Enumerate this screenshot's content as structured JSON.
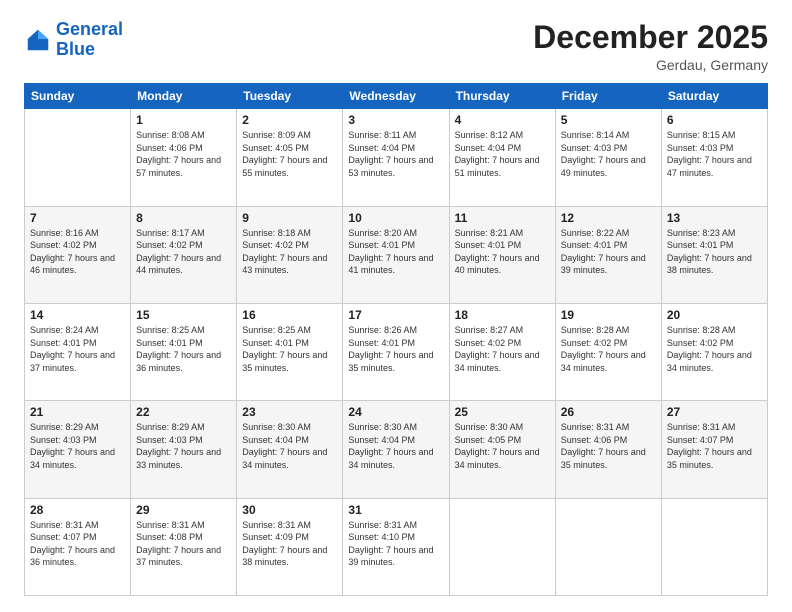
{
  "logo": {
    "line1": "General",
    "line2": "Blue"
  },
  "header": {
    "month": "December 2025",
    "location": "Gerdau, Germany"
  },
  "days_of_week": [
    "Sunday",
    "Monday",
    "Tuesday",
    "Wednesday",
    "Thursday",
    "Friday",
    "Saturday"
  ],
  "weeks": [
    [
      {
        "day": "",
        "sunrise": "",
        "sunset": "",
        "daylight": ""
      },
      {
        "day": "1",
        "sunrise": "Sunrise: 8:08 AM",
        "sunset": "Sunset: 4:06 PM",
        "daylight": "Daylight: 7 hours and 57 minutes."
      },
      {
        "day": "2",
        "sunrise": "Sunrise: 8:09 AM",
        "sunset": "Sunset: 4:05 PM",
        "daylight": "Daylight: 7 hours and 55 minutes."
      },
      {
        "day": "3",
        "sunrise": "Sunrise: 8:11 AM",
        "sunset": "Sunset: 4:04 PM",
        "daylight": "Daylight: 7 hours and 53 minutes."
      },
      {
        "day": "4",
        "sunrise": "Sunrise: 8:12 AM",
        "sunset": "Sunset: 4:04 PM",
        "daylight": "Daylight: 7 hours and 51 minutes."
      },
      {
        "day": "5",
        "sunrise": "Sunrise: 8:14 AM",
        "sunset": "Sunset: 4:03 PM",
        "daylight": "Daylight: 7 hours and 49 minutes."
      },
      {
        "day": "6",
        "sunrise": "Sunrise: 8:15 AM",
        "sunset": "Sunset: 4:03 PM",
        "daylight": "Daylight: 7 hours and 47 minutes."
      }
    ],
    [
      {
        "day": "7",
        "sunrise": "Sunrise: 8:16 AM",
        "sunset": "Sunset: 4:02 PM",
        "daylight": "Daylight: 7 hours and 46 minutes."
      },
      {
        "day": "8",
        "sunrise": "Sunrise: 8:17 AM",
        "sunset": "Sunset: 4:02 PM",
        "daylight": "Daylight: 7 hours and 44 minutes."
      },
      {
        "day": "9",
        "sunrise": "Sunrise: 8:18 AM",
        "sunset": "Sunset: 4:02 PM",
        "daylight": "Daylight: 7 hours and 43 minutes."
      },
      {
        "day": "10",
        "sunrise": "Sunrise: 8:20 AM",
        "sunset": "Sunset: 4:01 PM",
        "daylight": "Daylight: 7 hours and 41 minutes."
      },
      {
        "day": "11",
        "sunrise": "Sunrise: 8:21 AM",
        "sunset": "Sunset: 4:01 PM",
        "daylight": "Daylight: 7 hours and 40 minutes."
      },
      {
        "day": "12",
        "sunrise": "Sunrise: 8:22 AM",
        "sunset": "Sunset: 4:01 PM",
        "daylight": "Daylight: 7 hours and 39 minutes."
      },
      {
        "day": "13",
        "sunrise": "Sunrise: 8:23 AM",
        "sunset": "Sunset: 4:01 PM",
        "daylight": "Daylight: 7 hours and 38 minutes."
      }
    ],
    [
      {
        "day": "14",
        "sunrise": "Sunrise: 8:24 AM",
        "sunset": "Sunset: 4:01 PM",
        "daylight": "Daylight: 7 hours and 37 minutes."
      },
      {
        "day": "15",
        "sunrise": "Sunrise: 8:25 AM",
        "sunset": "Sunset: 4:01 PM",
        "daylight": "Daylight: 7 hours and 36 minutes."
      },
      {
        "day": "16",
        "sunrise": "Sunrise: 8:25 AM",
        "sunset": "Sunset: 4:01 PM",
        "daylight": "Daylight: 7 hours and 35 minutes."
      },
      {
        "day": "17",
        "sunrise": "Sunrise: 8:26 AM",
        "sunset": "Sunset: 4:01 PM",
        "daylight": "Daylight: 7 hours and 35 minutes."
      },
      {
        "day": "18",
        "sunrise": "Sunrise: 8:27 AM",
        "sunset": "Sunset: 4:02 PM",
        "daylight": "Daylight: 7 hours and 34 minutes."
      },
      {
        "day": "19",
        "sunrise": "Sunrise: 8:28 AM",
        "sunset": "Sunset: 4:02 PM",
        "daylight": "Daylight: 7 hours and 34 minutes."
      },
      {
        "day": "20",
        "sunrise": "Sunrise: 8:28 AM",
        "sunset": "Sunset: 4:02 PM",
        "daylight": "Daylight: 7 hours and 34 minutes."
      }
    ],
    [
      {
        "day": "21",
        "sunrise": "Sunrise: 8:29 AM",
        "sunset": "Sunset: 4:03 PM",
        "daylight": "Daylight: 7 hours and 34 minutes."
      },
      {
        "day": "22",
        "sunrise": "Sunrise: 8:29 AM",
        "sunset": "Sunset: 4:03 PM",
        "daylight": "Daylight: 7 hours and 33 minutes."
      },
      {
        "day": "23",
        "sunrise": "Sunrise: 8:30 AM",
        "sunset": "Sunset: 4:04 PM",
        "daylight": "Daylight: 7 hours and 34 minutes."
      },
      {
        "day": "24",
        "sunrise": "Sunrise: 8:30 AM",
        "sunset": "Sunset: 4:04 PM",
        "daylight": "Daylight: 7 hours and 34 minutes."
      },
      {
        "day": "25",
        "sunrise": "Sunrise: 8:30 AM",
        "sunset": "Sunset: 4:05 PM",
        "daylight": "Daylight: 7 hours and 34 minutes."
      },
      {
        "day": "26",
        "sunrise": "Sunrise: 8:31 AM",
        "sunset": "Sunset: 4:06 PM",
        "daylight": "Daylight: 7 hours and 35 minutes."
      },
      {
        "day": "27",
        "sunrise": "Sunrise: 8:31 AM",
        "sunset": "Sunset: 4:07 PM",
        "daylight": "Daylight: 7 hours and 35 minutes."
      }
    ],
    [
      {
        "day": "28",
        "sunrise": "Sunrise: 8:31 AM",
        "sunset": "Sunset: 4:07 PM",
        "daylight": "Daylight: 7 hours and 36 minutes."
      },
      {
        "day": "29",
        "sunrise": "Sunrise: 8:31 AM",
        "sunset": "Sunset: 4:08 PM",
        "daylight": "Daylight: 7 hours and 37 minutes."
      },
      {
        "day": "30",
        "sunrise": "Sunrise: 8:31 AM",
        "sunset": "Sunset: 4:09 PM",
        "daylight": "Daylight: 7 hours and 38 minutes."
      },
      {
        "day": "31",
        "sunrise": "Sunrise: 8:31 AM",
        "sunset": "Sunset: 4:10 PM",
        "daylight": "Daylight: 7 hours and 39 minutes."
      },
      {
        "day": "",
        "sunrise": "",
        "sunset": "",
        "daylight": ""
      },
      {
        "day": "",
        "sunrise": "",
        "sunset": "",
        "daylight": ""
      },
      {
        "day": "",
        "sunrise": "",
        "sunset": "",
        "daylight": ""
      }
    ]
  ]
}
